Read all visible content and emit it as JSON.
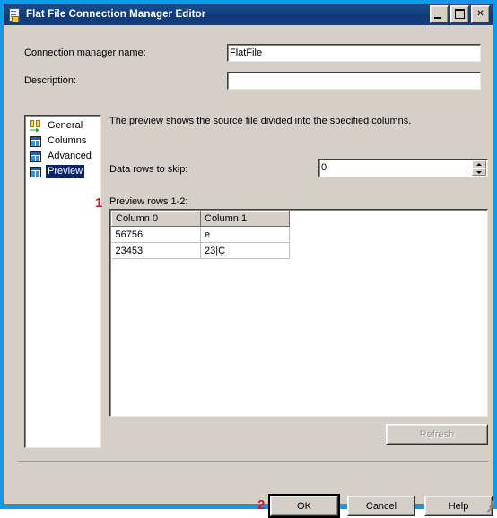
{
  "window": {
    "title": "Flat File Connection Manager Editor",
    "icon": "flat-file-document-icon",
    "controls": {
      "minimize": "Minimize",
      "maximize": "Maximize",
      "close": "Close"
    },
    "accent_color": "#0d9ae8",
    "titlebar_color": "#14427f",
    "face_color": "#d4d0c8"
  },
  "fields": {
    "connection_name_label": "Connection manager name:",
    "connection_name_value": "FlatFile",
    "connection_name_placeholder": "",
    "description_label": "Description:",
    "description_value": "",
    "description_placeholder": ""
  },
  "tree": {
    "items": [
      {
        "label": "General",
        "icon": "columns-arrow-icon",
        "selected": false
      },
      {
        "label": "Columns",
        "icon": "grid-icon",
        "selected": false
      },
      {
        "label": "Advanced",
        "icon": "grid-icon",
        "selected": false
      },
      {
        "label": "Preview",
        "icon": "grid-icon",
        "selected": true
      }
    ]
  },
  "panel": {
    "description": "The preview shows the source file divided into the specified columns.",
    "skip_label": "Data rows to skip:",
    "skip_value": "0",
    "skip_placeholder": "",
    "preview_rows_label": "Preview rows 1-2:"
  },
  "grid": {
    "columns": [
      "Column 0",
      "Column 1"
    ],
    "rows": [
      [
        "56756",
        "e"
      ],
      [
        "23453",
        "23|Ç"
      ]
    ]
  },
  "buttons": {
    "refresh": "Refresh",
    "refresh_enabled": false,
    "ok": "OK",
    "cancel": "Cancel",
    "help": "Help"
  },
  "annotations": [
    {
      "label": "1",
      "color": "#d81920"
    },
    {
      "label": "2",
      "color": "#d81920"
    }
  ]
}
